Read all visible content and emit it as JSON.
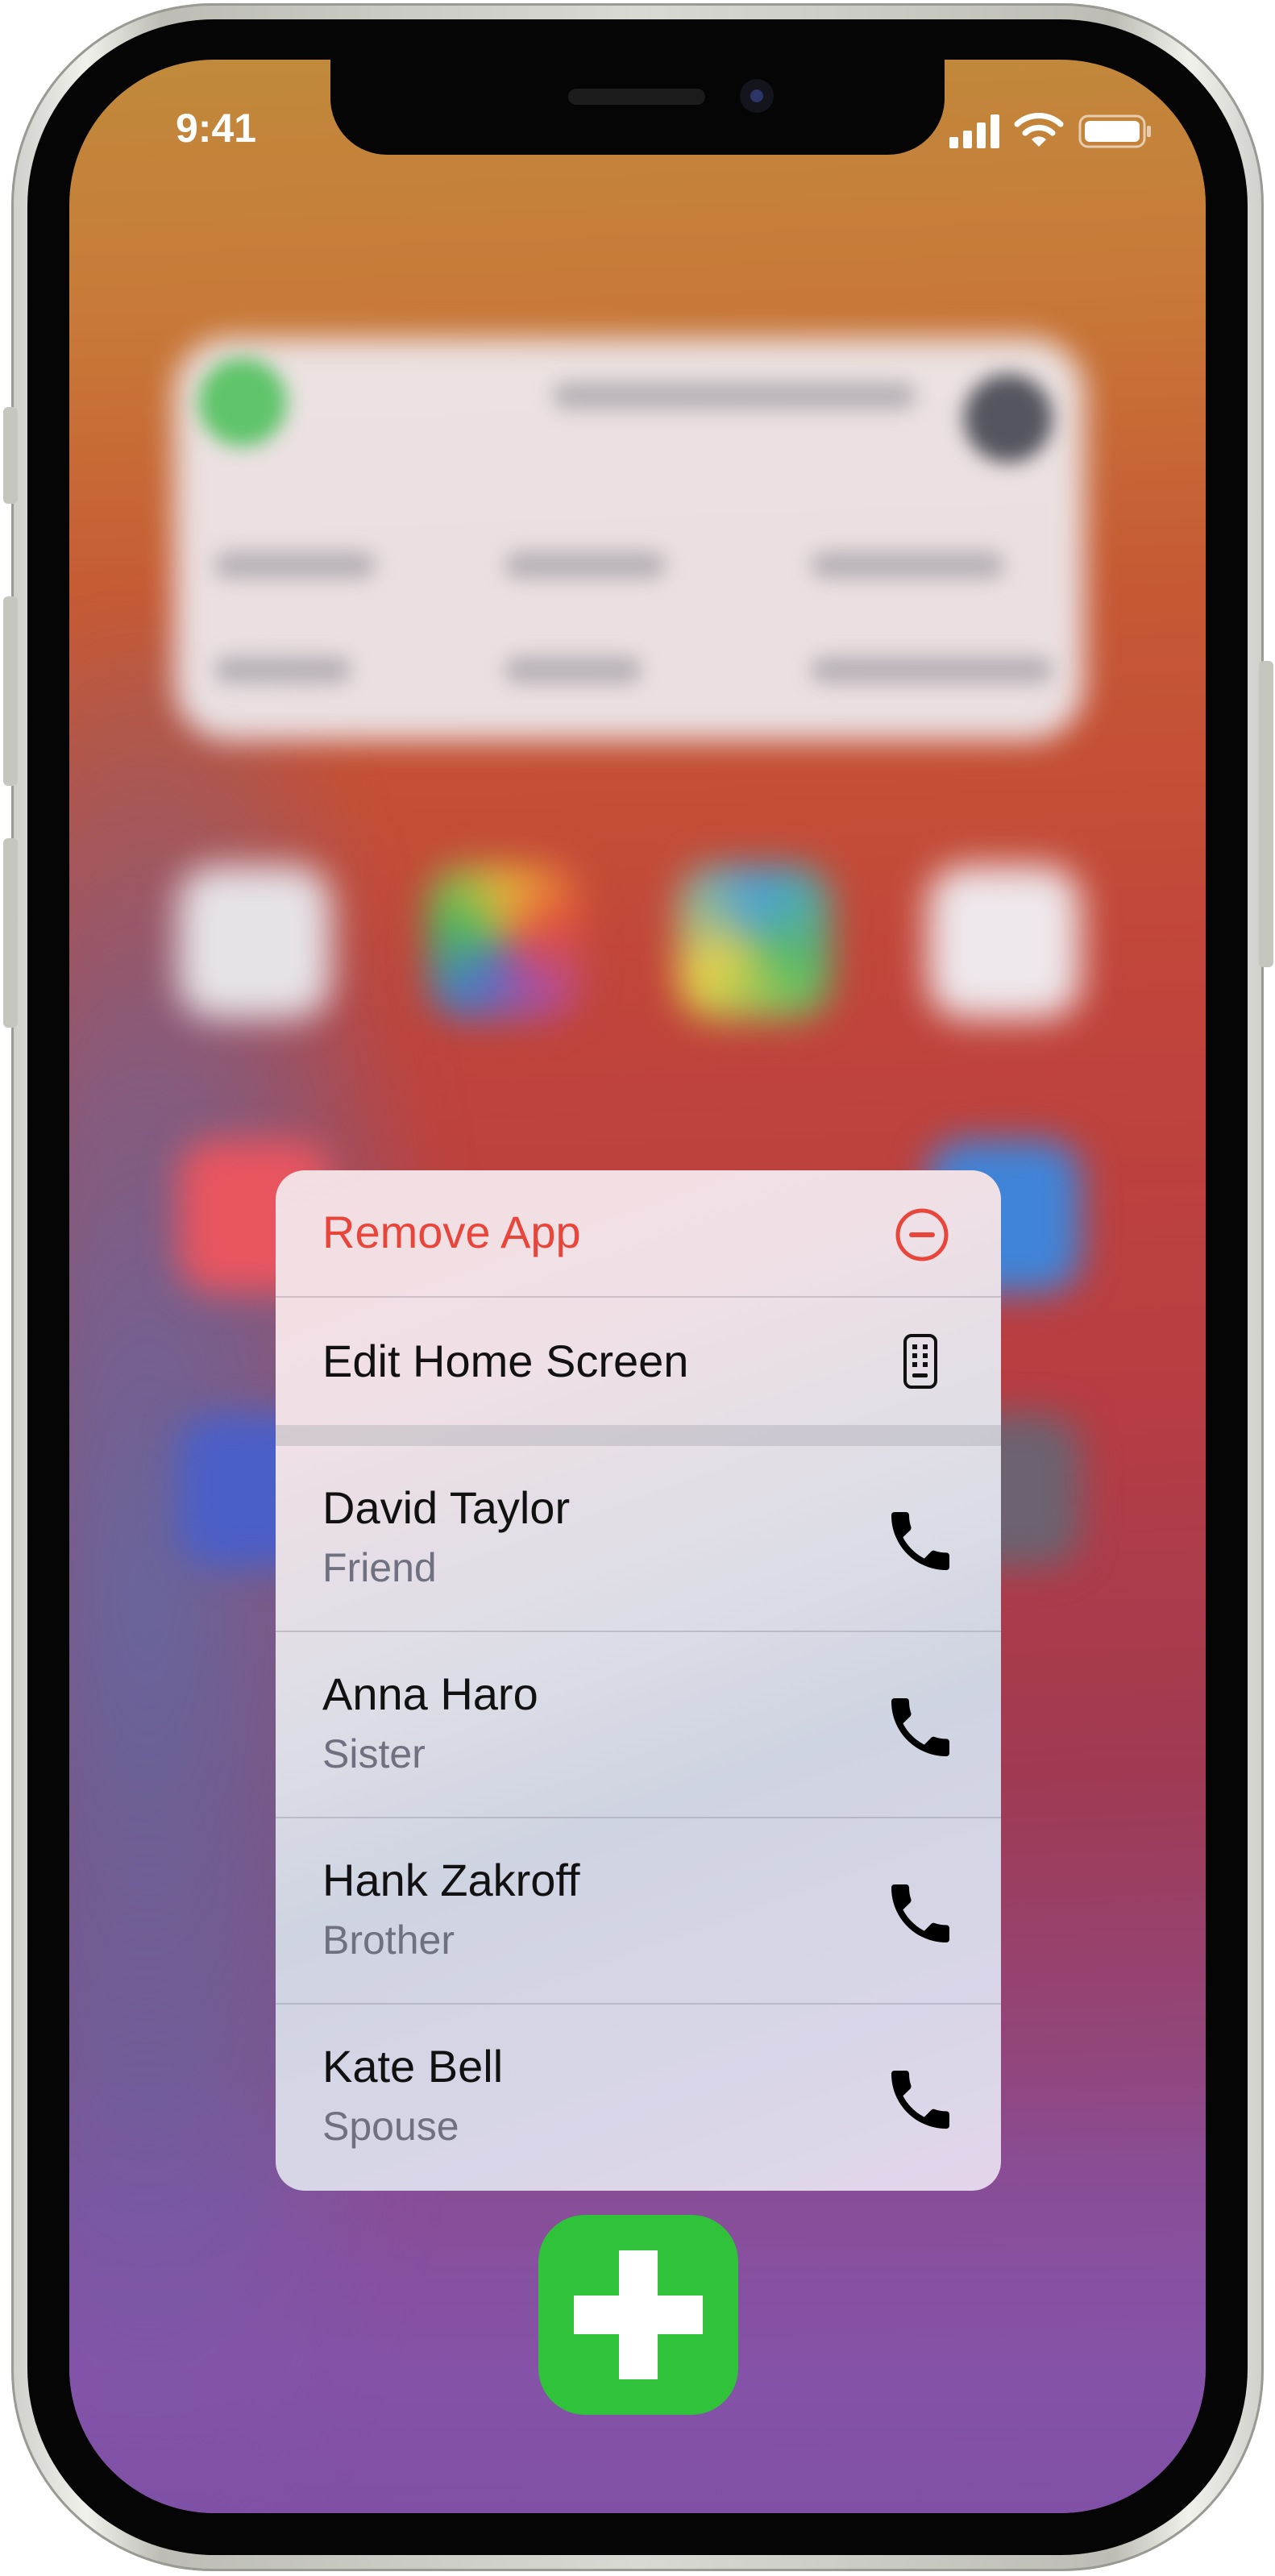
{
  "status_bar": {
    "time": "9:41",
    "icons": [
      "signal-icon",
      "wifi-icon",
      "battery-icon"
    ]
  },
  "context_menu": {
    "remove_label": "Remove App",
    "remove_color": "#e8453b",
    "edit_label": "Edit Home Screen",
    "contacts": [
      {
        "name": "David Taylor",
        "relation": "Friend"
      },
      {
        "name": "Anna Haro",
        "relation": "Sister"
      },
      {
        "name": "Hank Zakroff",
        "relation": "Brother"
      },
      {
        "name": "Kate Bell",
        "relation": "Spouse"
      }
    ]
  },
  "app_icon": {
    "name": "plus-app-icon",
    "color": "#2fc23a"
  }
}
